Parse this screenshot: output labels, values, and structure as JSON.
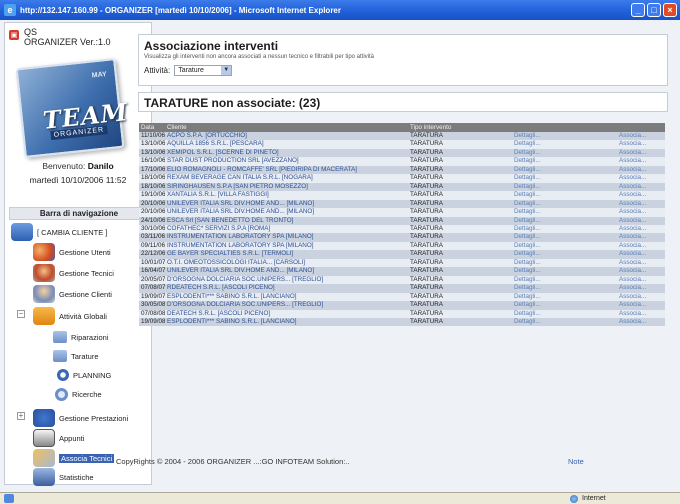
{
  "window": {
    "title": "http://132.147.160.99 - ORGANIZER [martedì 10/10/2006] - Microsoft Internet Explorer"
  },
  "sidebar": {
    "app_title_line1": "QS",
    "app_title_line2": "ORGANIZER Ver.:1.0",
    "logo_text": "TEAM",
    "logo_sub": "ORGANIZER",
    "logo_corner": "MAY",
    "welcome_label": "Benvenuto:",
    "welcome_user": "Danilo",
    "date": "martedì 10/10/2006 11:52",
    "nav_header": "Barra di navigazione",
    "items": [
      {
        "label": "[ CAMBIA CLIENTE ]",
        "icon": "monitor-icon"
      },
      {
        "label": "Gestione Utenti",
        "icon": "users-icon"
      },
      {
        "label": "Gestione Tecnici",
        "icon": "technicians-icon"
      },
      {
        "label": "Gestione Clienti",
        "icon": "clients-icon"
      },
      {
        "label": "Attività Globali",
        "icon": "folder-calendar-icon"
      },
      {
        "label": "Riparazioni",
        "icon": "repair-icon"
      },
      {
        "label": "Tarature",
        "icon": "calibration-icon"
      },
      {
        "label": "PLANNING",
        "icon": "planning-icon"
      },
      {
        "label": "Ricerche",
        "icon": "search-icon"
      },
      {
        "label": "Gestione Prestazioni",
        "icon": "services-icon"
      },
      {
        "label": "Appunti",
        "icon": "notes-icon"
      },
      {
        "label": "Associa Tecnici",
        "icon": "assign-icon"
      },
      {
        "label": "Statistiche",
        "icon": "stats-icon"
      }
    ]
  },
  "header": {
    "title": "Associazione interventi",
    "subtitle": "Visualizza gli interventi non ancora associati a nessun tecnico e filtrabili per tipo attività",
    "filter_label": "Attività:",
    "filter_value": "Tarature"
  },
  "section_title": "TARATURE non associate: (23)",
  "table": {
    "columns": [
      "Data",
      "Cliente",
      "Tipo intervento",
      "",
      ""
    ],
    "rows": [
      [
        "11/10/06",
        "ACPO S.P.A. [ORTUCCHIO]",
        "TARATURA",
        "Dettagli...",
        "Associa..."
      ],
      [
        "13/10/06",
        "AQUILLA 1856 S.R.L. [PESCARA]",
        "TARATURA",
        "Dettagli...",
        "Associa..."
      ],
      [
        "13/10/06",
        "XEMIPOL S.R.L. [SCERNE DI PINETO]",
        "TARATURA",
        "Dettagli...",
        "Associa..."
      ],
      [
        "16/10/06",
        "STAR DUST PRODUCTION SRL [AVEZZANO]",
        "TARATURA",
        "Dettagli...",
        "Associa..."
      ],
      [
        "17/10/06",
        "ELIO ROMAGNOLI - ROMCAFFE' SRL [PIEDIRIPA DI MACERATA]",
        "TARATURA",
        "Dettagli...",
        "Associa..."
      ],
      [
        "18/10/06",
        "REXAM BEVERAGE CAN ITALIA S.R.L. [NOGARA]",
        "TARATURA",
        "Dettagli...",
        "Associa..."
      ],
      [
        "18/10/06",
        "SIRINGHAUSEN S.P.A [SAN PIETRO MOSEZZO]",
        "TARATURA",
        "Dettagli...",
        "Associa..."
      ],
      [
        "19/10/06",
        "XANTALIA S.R.L. [VILLA FASTIGGI]",
        "TARATURA",
        "Dettagli...",
        "Associa..."
      ],
      [
        "20/10/06",
        "UNILEVER ITALIA SRL DIV.HOME AND... [MILANO]",
        "TARATURA",
        "Dettagli...",
        "Associa..."
      ],
      [
        "20/10/06",
        "UNILEVER ITALIA SRL DIV.HOME AND... [MILANO]",
        "TARATURA",
        "Dettagli...",
        "Associa..."
      ],
      [
        "24/10/06",
        "ESCA Srl [SAN BENEDETTO DEL TRONTO]",
        "TARATURA",
        "Dettagli...",
        "Associa..."
      ],
      [
        "30/10/06",
        "COFATHEC* SERVIZI S.P.A [ROMA]",
        "TARATURA",
        "Dettagli...",
        "Associa..."
      ],
      [
        "03/11/06",
        "INSTRUMENTATION LABORATORY SPA [MILANO]",
        "TARATURA",
        "Dettagli...",
        "Associa..."
      ],
      [
        "09/11/06",
        "INSTRUMENTATION LABORATORY SPA [MILANO]",
        "TARATURA",
        "Dettagli...",
        "Associa..."
      ],
      [
        "22/12/06",
        "GE BAYER SPECIALTIES S.R.L. [TERMOLI]",
        "TARATURA",
        "Dettagli...",
        "Associa..."
      ],
      [
        "10/01/07",
        "O.T.I. OMEOTOSSICOLOGI ITALIA... [CARSOLI]",
        "TARATURA",
        "Dettagli...",
        "Associa..."
      ],
      [
        "16/04/07",
        "UNILEVER ITALIA SRL DIV.HOME AND... [MILANO]",
        "TARATURA",
        "Dettagli...",
        "Associa..."
      ],
      [
        "20/05/07",
        "D'ORSOGNA DOLCIARIA SOC.UNIPERS... [TREGLIO]",
        "TARATURA",
        "Dettagli...",
        "Associa..."
      ],
      [
        "07/08/07",
        "RDEATECH S.R.L. [ASCOLI PICENO]",
        "TARATURA",
        "Dettagli...",
        "Associa..."
      ],
      [
        "19/09/07",
        "ESPLODENTI*** SABINO S.R.L. [LANCIANO]",
        "TARATURA",
        "Dettagli...",
        "Associa..."
      ],
      [
        "30/05/08",
        "D'ORSOGNA DOLCIARIA SOC.UNIPERS... [TREGLIO]",
        "TARATURA",
        "Dettagli...",
        "Associa..."
      ],
      [
        "07/08/08",
        "DEATECH S.R.L. [ASCOLI PICENO]",
        "TARATURA",
        "Dettagli...",
        "Associa..."
      ],
      [
        "19/09/08",
        "ESPLODENTI*** SABINO S.R.L. [LANCIANO]",
        "TARATURA",
        "Dettagli...",
        "Associa..."
      ]
    ]
  },
  "footer": {
    "copyright": "CopyRights © 2004 - 2006 ORGANIZER ...:GO INFOTEAM Solution:..",
    "notes_link": "Note"
  },
  "statusbar": {
    "zone": "Internet"
  }
}
